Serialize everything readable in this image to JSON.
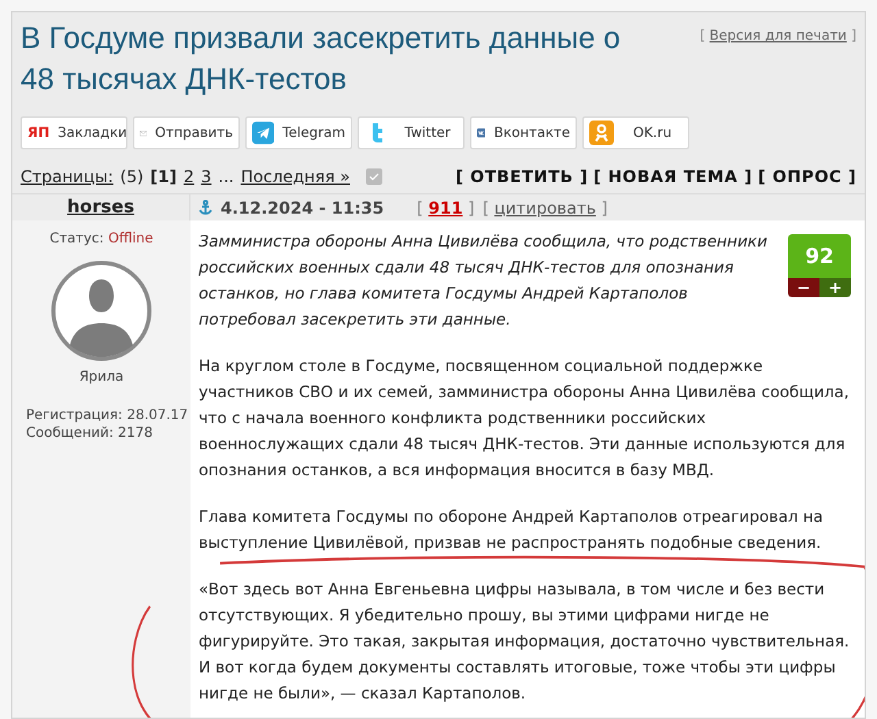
{
  "topic": {
    "title": "В Госдуме призвали засекретить данные о 48 тысячах ДНК-тестов",
    "print_link": {
      "open": "[",
      "label": "Версия для печати",
      "close": "]"
    }
  },
  "share_buttons": [
    {
      "kind": "yandex",
      "logo": "ЯП",
      "label": "Закладки"
    },
    {
      "kind": "mail",
      "label": "Отправить"
    },
    {
      "kind": "telegram",
      "label": "Telegram"
    },
    {
      "kind": "twitter",
      "label": "Twitter"
    },
    {
      "kind": "vk",
      "label": "Вконтакте"
    },
    {
      "kind": "ok",
      "label": "OK.ru"
    }
  ],
  "pagination": {
    "label": "Страницы:",
    "count": "(5)",
    "pages": [
      {
        "label": "[1]",
        "selected": true
      },
      {
        "label": "2",
        "selected": false
      },
      {
        "label": "3",
        "selected": false
      }
    ],
    "ellipsis": "...",
    "last": "Последняя »"
  },
  "actions": [
    "[ ОТВЕТИТЬ ]",
    "[ НОВАЯ ТЕМА ]",
    "[ ОПРОС ]"
  ],
  "post": {
    "author": "horses",
    "date": "4.12.2024 - 11:35",
    "number": {
      "open": "[",
      "label": "911",
      "close": "]"
    },
    "quote_link": {
      "open": "[",
      "label": "цитировать",
      "close": "]"
    },
    "status_label": "Статус:",
    "status": "Offline",
    "group": "Ярила",
    "registration": "Регистрация: 28.07.17",
    "messages": "Сообщений: 2178",
    "rating": "92",
    "rating_minus": "−",
    "rating_plus": "+",
    "paragraphs": [
      {
        "kind": "lead",
        "text": "Замминистра обороны Анна Цивилёва сообщила, что родственники российских военных сдали 48 тысяч ДНК-тестов для опознания останков, но глава комитета Госдумы Андрей Картаполов потребовал засекретить эти данные."
      },
      {
        "kind": "plain",
        "text": "На круглом столе в Госдуме, посвященном социальной поддержке участников СВО и их семей, замминистра обороны Анна Цивилёва сообщила, что с начала военного конфликта родственники российских военнослужащих сдали 48 тысяч ДНК-тестов. Эти данные используются для опознания останков, а вся информация вносится в базу МВД."
      },
      {
        "kind": "plain",
        "text": "Глава комитета Госдумы по обороне Андрей Картаполов отреагировал на выступление Цивилёвой, призвав не распространять подобные сведения."
      },
      {
        "kind": "plain",
        "text": "«Вот здесь вот Анна Евгеньевна цифры называла, в том числе и без вести отсутствующих. Я убедительно прошу, вы этими цифрами нигде не фигурируйте. Это такая, закрытая информация, достаточно чувствительная. И вот когда будем документы составлять итоговые, тоже чтобы эти цифры нигде не были», — сказал Картаполов."
      }
    ]
  }
}
